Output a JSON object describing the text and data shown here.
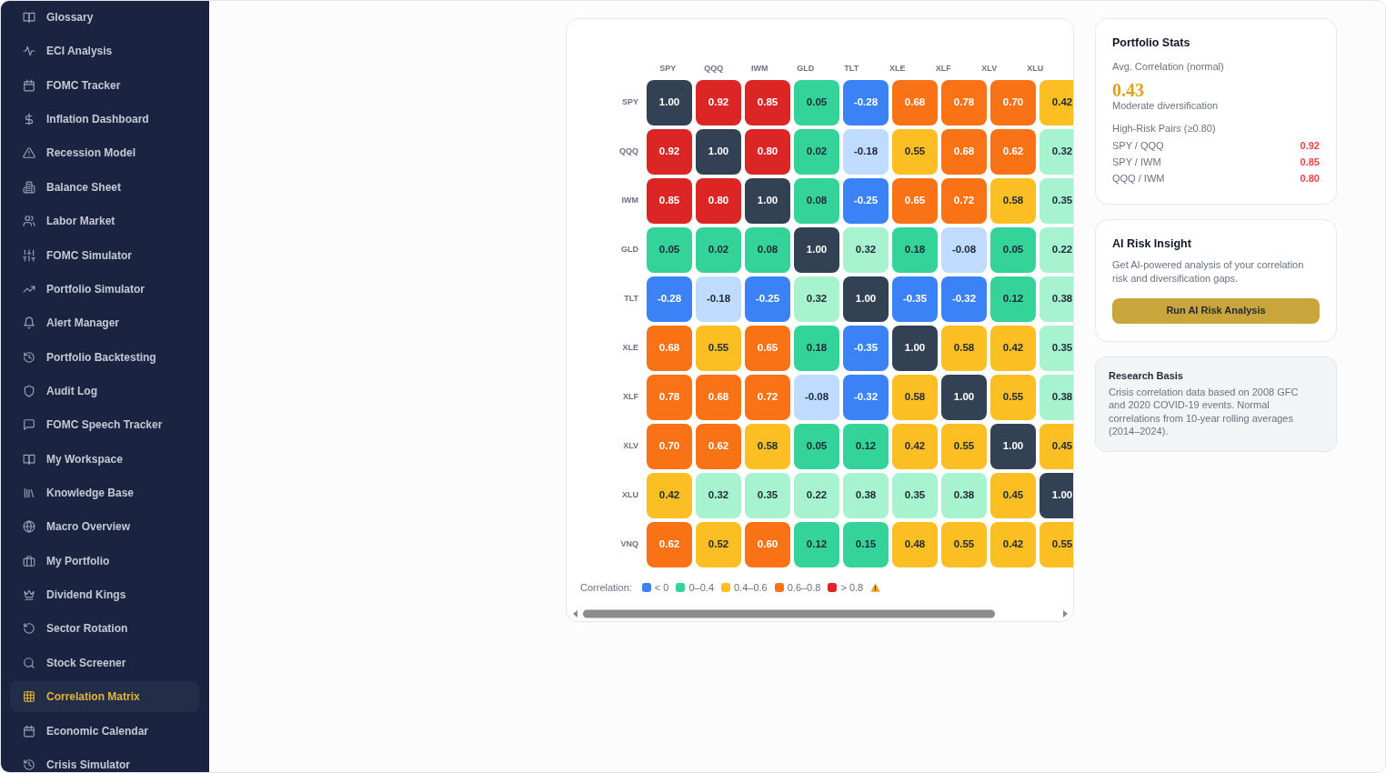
{
  "sidebar": {
    "items": [
      {
        "label": "Glossary",
        "selected": false
      },
      {
        "label": "ECI Analysis",
        "selected": false
      },
      {
        "label": "FOMC Tracker",
        "selected": false
      },
      {
        "label": "Inflation Dashboard",
        "selected": false
      },
      {
        "label": "Recession Model",
        "selected": false
      },
      {
        "label": "Balance Sheet",
        "selected": false
      },
      {
        "label": "Labor Market",
        "selected": false
      },
      {
        "label": "FOMC Simulator",
        "selected": false
      },
      {
        "label": "Portfolio Simulator",
        "selected": false
      },
      {
        "label": "Alert Manager",
        "selected": false
      },
      {
        "label": "Portfolio Backtesting",
        "selected": false
      },
      {
        "label": "Audit Log",
        "selected": false
      },
      {
        "label": "FOMC Speech Tracker",
        "selected": false
      },
      {
        "label": "My Workspace",
        "selected": false
      },
      {
        "label": "Knowledge Base",
        "selected": false
      },
      {
        "label": "Macro Overview",
        "selected": false
      },
      {
        "label": "My Portfolio",
        "selected": false
      },
      {
        "label": "Dividend Kings",
        "selected": false
      },
      {
        "label": "Sector Rotation",
        "selected": false
      },
      {
        "label": "Stock Screener",
        "selected": false
      },
      {
        "label": "Correlation Matrix",
        "selected": true
      },
      {
        "label": "Economic Calendar",
        "selected": false
      },
      {
        "label": "Crisis Simulator",
        "selected": false
      }
    ]
  },
  "matrix": {
    "columns": [
      "SPY",
      "QQQ",
      "IWM",
      "GLD",
      "TLT",
      "XLE",
      "XLF",
      "XLV",
      "XLU"
    ],
    "rows": [
      {
        "label": "SPY",
        "cells": [
          {
            "value": "1.00",
            "color": "#334155"
          },
          {
            "value": "0.92",
            "color": "#dc2626"
          },
          {
            "value": "0.85",
            "color": "#dc2626"
          },
          {
            "value": "0.05",
            "color": "#34d399"
          },
          {
            "value": "-0.28",
            "color": "#3b82f6"
          },
          {
            "value": "0.68",
            "color": "#f97316"
          },
          {
            "value": "0.78",
            "color": "#f97316"
          },
          {
            "value": "0.70",
            "color": "#f97316"
          },
          {
            "value": "0.42",
            "color": "#fbbf24"
          }
        ]
      },
      {
        "label": "QQQ",
        "cells": [
          {
            "value": "0.92",
            "color": "#dc2626"
          },
          {
            "value": "1.00",
            "color": "#334155"
          },
          {
            "value": "0.80",
            "color": "#dc2626"
          },
          {
            "value": "0.02",
            "color": "#34d399"
          },
          {
            "value": "-0.18",
            "color": "#bfdbfe"
          },
          {
            "value": "0.55",
            "color": "#fbbf24"
          },
          {
            "value": "0.68",
            "color": "#f97316"
          },
          {
            "value": "0.62",
            "color": "#f97316"
          },
          {
            "value": "0.32",
            "color": "#a7f3d0"
          }
        ]
      },
      {
        "label": "IWM",
        "cells": [
          {
            "value": "0.85",
            "color": "#dc2626"
          },
          {
            "value": "0.80",
            "color": "#dc2626"
          },
          {
            "value": "1.00",
            "color": "#334155"
          },
          {
            "value": "0.08",
            "color": "#34d399"
          },
          {
            "value": "-0.25",
            "color": "#3b82f6"
          },
          {
            "value": "0.65",
            "color": "#f97316"
          },
          {
            "value": "0.72",
            "color": "#f97316"
          },
          {
            "value": "0.58",
            "color": "#fbbf24"
          },
          {
            "value": "0.35",
            "color": "#a7f3d0"
          }
        ]
      },
      {
        "label": "GLD",
        "cells": [
          {
            "value": "0.05",
            "color": "#34d399"
          },
          {
            "value": "0.02",
            "color": "#34d399"
          },
          {
            "value": "0.08",
            "color": "#34d399"
          },
          {
            "value": "1.00",
            "color": "#334155"
          },
          {
            "value": "0.32",
            "color": "#a7f3d0"
          },
          {
            "value": "0.18",
            "color": "#34d399"
          },
          {
            "value": "-0.08",
            "color": "#bfdbfe"
          },
          {
            "value": "0.05",
            "color": "#34d399"
          },
          {
            "value": "0.22",
            "color": "#a7f3d0"
          }
        ]
      },
      {
        "label": "TLT",
        "cells": [
          {
            "value": "-0.28",
            "color": "#3b82f6"
          },
          {
            "value": "-0.18",
            "color": "#bfdbfe"
          },
          {
            "value": "-0.25",
            "color": "#3b82f6"
          },
          {
            "value": "0.32",
            "color": "#a7f3d0"
          },
          {
            "value": "1.00",
            "color": "#334155"
          },
          {
            "value": "-0.35",
            "color": "#3b82f6"
          },
          {
            "value": "-0.32",
            "color": "#3b82f6"
          },
          {
            "value": "0.12",
            "color": "#34d399"
          },
          {
            "value": "0.38",
            "color": "#a7f3d0"
          }
        ]
      },
      {
        "label": "XLE",
        "cells": [
          {
            "value": "0.68",
            "color": "#f97316"
          },
          {
            "value": "0.55",
            "color": "#fbbf24"
          },
          {
            "value": "0.65",
            "color": "#f97316"
          },
          {
            "value": "0.18",
            "color": "#34d399"
          },
          {
            "value": "-0.35",
            "color": "#3b82f6"
          },
          {
            "value": "1.00",
            "color": "#334155"
          },
          {
            "value": "0.58",
            "color": "#fbbf24"
          },
          {
            "value": "0.42",
            "color": "#fbbf24"
          },
          {
            "value": "0.35",
            "color": "#a7f3d0"
          }
        ]
      },
      {
        "label": "XLF",
        "cells": [
          {
            "value": "0.78",
            "color": "#f97316"
          },
          {
            "value": "0.68",
            "color": "#f97316"
          },
          {
            "value": "0.72",
            "color": "#f97316"
          },
          {
            "value": "-0.08",
            "color": "#bfdbfe"
          },
          {
            "value": "-0.32",
            "color": "#3b82f6"
          },
          {
            "value": "0.58",
            "color": "#fbbf24"
          },
          {
            "value": "1.00",
            "color": "#334155"
          },
          {
            "value": "0.55",
            "color": "#fbbf24"
          },
          {
            "value": "0.38",
            "color": "#a7f3d0"
          }
        ]
      },
      {
        "label": "XLV",
        "cells": [
          {
            "value": "0.70",
            "color": "#f97316"
          },
          {
            "value": "0.62",
            "color": "#f97316"
          },
          {
            "value": "0.58",
            "color": "#fbbf24"
          },
          {
            "value": "0.05",
            "color": "#34d399"
          },
          {
            "value": "0.12",
            "color": "#34d399"
          },
          {
            "value": "0.42",
            "color": "#fbbf24"
          },
          {
            "value": "0.55",
            "color": "#fbbf24"
          },
          {
            "value": "1.00",
            "color": "#334155"
          },
          {
            "value": "0.45",
            "color": "#fbbf24"
          }
        ]
      },
      {
        "label": "XLU",
        "cells": [
          {
            "value": "0.42",
            "color": "#fbbf24"
          },
          {
            "value": "0.32",
            "color": "#a7f3d0"
          },
          {
            "value": "0.35",
            "color": "#a7f3d0"
          },
          {
            "value": "0.22",
            "color": "#a7f3d0"
          },
          {
            "value": "0.38",
            "color": "#a7f3d0"
          },
          {
            "value": "0.35",
            "color": "#a7f3d0"
          },
          {
            "value": "0.38",
            "color": "#a7f3d0"
          },
          {
            "value": "0.45",
            "color": "#fbbf24"
          },
          {
            "value": "1.00",
            "color": "#334155"
          }
        ]
      },
      {
        "label": "VNQ",
        "cells": [
          {
            "value": "0.62",
            "color": "#f97316"
          },
          {
            "value": "0.52",
            "color": "#fbbf24"
          },
          {
            "value": "0.60",
            "color": "#f97316"
          },
          {
            "value": "0.12",
            "color": "#34d399"
          },
          {
            "value": "0.15",
            "color": "#34d399"
          },
          {
            "value": "0.48",
            "color": "#fbbf24"
          },
          {
            "value": "0.55",
            "color": "#fbbf24"
          },
          {
            "value": "0.42",
            "color": "#fbbf24"
          },
          {
            "value": "0.55",
            "color": "#fbbf24"
          }
        ]
      }
    ],
    "legend": {
      "title": "Correlation:",
      "items": [
        {
          "label": "< 0",
          "color": "#3b82f6",
          "warning": false
        },
        {
          "label": "0–0.4",
          "color": "#34d399",
          "warning": false
        },
        {
          "label": "0.4–0.6",
          "color": "#fbbf24",
          "warning": false
        },
        {
          "label": "0.6–0.8",
          "color": "#f97316",
          "warning": false
        },
        {
          "label": "> 0.8",
          "color": "#dc2626",
          "warning": true
        }
      ]
    }
  },
  "portfolio_stats": {
    "title": "Portfolio Stats",
    "avg_label": "Avg. Correlation (normal)",
    "avg_value": "0.43",
    "avg_note": "Moderate diversification",
    "pairs_title": "High-Risk Pairs (≥0.80)",
    "pairs": [
      {
        "pair": "SPY / QQQ",
        "value": "0.92"
      },
      {
        "pair": "SPY / IWM",
        "value": "0.85"
      },
      {
        "pair": "QQQ / IWM",
        "value": "0.80"
      }
    ]
  },
  "ai_insight": {
    "title": "AI Risk Insight",
    "description": "Get AI-powered analysis of your correlation risk and diversification gaps.",
    "button": "Run AI Risk Analysis"
  },
  "research_basis": {
    "title": "Research Basis",
    "text": "Crisis correlation data based on 2008 GFC and 2020 COVID-19 events. Normal correlations from 10-year rolling averages (2014–2024)."
  }
}
